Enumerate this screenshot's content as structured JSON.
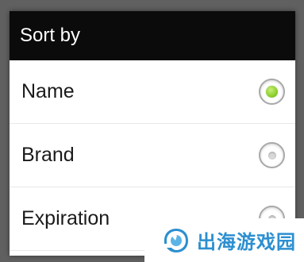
{
  "dialog": {
    "title": "Sort by",
    "options": [
      {
        "label": "Name",
        "selected": true
      },
      {
        "label": "Brand",
        "selected": false
      },
      {
        "label": "Expiration",
        "selected": false
      }
    ]
  },
  "watermark": {
    "text": "出海游戏园",
    "color": "#2c8fd0"
  },
  "colors": {
    "header_bg": "#0b0b0b",
    "radio_selected": "#8ccf2a"
  }
}
